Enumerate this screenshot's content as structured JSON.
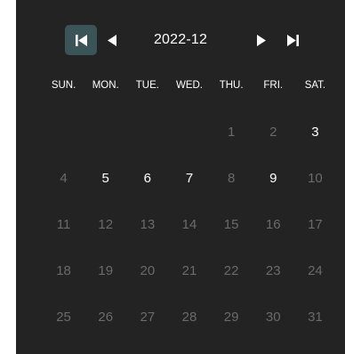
{
  "calendar": {
    "month_label": "2022-12",
    "nav": {
      "first_icon": "skip-to-first-icon",
      "prev_icon": "triangle-left-icon",
      "next_icon": "triangle-right-icon",
      "last_icon": "skip-to-last-icon"
    },
    "weekdays": [
      "SUN.",
      "MON.",
      "TUE.",
      "WED.",
      "THU.",
      "FRI.",
      "SAT."
    ],
    "days": [
      {
        "label": "",
        "state": "empty"
      },
      {
        "label": "",
        "state": "empty"
      },
      {
        "label": "",
        "state": "empty"
      },
      {
        "label": "",
        "state": "empty"
      },
      {
        "label": "1",
        "state": "disabled"
      },
      {
        "label": "2",
        "state": "disabled"
      },
      {
        "label": "3",
        "state": "available"
      },
      {
        "label": "4",
        "state": "disabled"
      },
      {
        "label": "5",
        "state": "available"
      },
      {
        "label": "6",
        "state": "available"
      },
      {
        "label": "7",
        "state": "available"
      },
      {
        "label": "8",
        "state": "disabled"
      },
      {
        "label": "9",
        "state": "available"
      },
      {
        "label": "10",
        "state": "disabled"
      },
      {
        "label": "11",
        "state": "disabled"
      },
      {
        "label": "12",
        "state": "disabled"
      },
      {
        "label": "13",
        "state": "disabled"
      },
      {
        "label": "14",
        "state": "disabled"
      },
      {
        "label": "15",
        "state": "disabled"
      },
      {
        "label": "16",
        "state": "disabled"
      },
      {
        "label": "17",
        "state": "disabled"
      },
      {
        "label": "18",
        "state": "disabled"
      },
      {
        "label": "19",
        "state": "disabled"
      },
      {
        "label": "20",
        "state": "disabled"
      },
      {
        "label": "21",
        "state": "disabled"
      },
      {
        "label": "22",
        "state": "disabled"
      },
      {
        "label": "23",
        "state": "disabled"
      },
      {
        "label": "24",
        "state": "disabled"
      },
      {
        "label": "25",
        "state": "disabled"
      },
      {
        "label": "26",
        "state": "disabled"
      },
      {
        "label": "27",
        "state": "disabled"
      },
      {
        "label": "28",
        "state": "disabled"
      },
      {
        "label": "29",
        "state": "disabled"
      },
      {
        "label": "30",
        "state": "disabled"
      },
      {
        "label": "31",
        "state": "disabled"
      }
    ],
    "colors": {
      "background": "#232323",
      "available_text": "#ffffff",
      "disabled_text": "#6a6a6a",
      "active_button": "#3b5457"
    }
  }
}
